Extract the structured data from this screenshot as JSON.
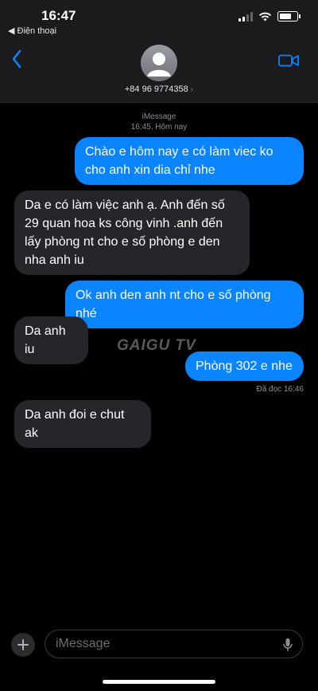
{
  "status_bar": {
    "time": "16:47",
    "back_app": "◀ Điện thoại"
  },
  "header": {
    "contact_number": "+84 96 9774358",
    "chevron": "›"
  },
  "thread_meta": {
    "service": "iMessage",
    "timestamp": "16:45, Hôm nay"
  },
  "messages": [
    {
      "from": "me",
      "text": "Chào e hôm nay e có làm viec ko cho anh xin dia chỉ nhe"
    },
    {
      "from": "them",
      "text": "Da e có làm việc anh ạ. Anh đến số 29 quan hoa ks công vinh .anh đến lấy phòng nt cho e số phòng e den nha anh iu"
    },
    {
      "from": "me",
      "text": "Ok anh den anh nt cho e số phòng nhé"
    },
    {
      "from": "them",
      "text": "Da anh iu"
    },
    {
      "from": "me",
      "text": "Phòng 302 e nhe"
    },
    {
      "from": "them",
      "text": "Da anh đoi e chut ak"
    }
  ],
  "read_receipt": "Đã đọc 16:46",
  "watermark": "GAIGU TV",
  "composer": {
    "placeholder": "iMessage"
  },
  "colors": {
    "sent": "#0a84ff",
    "received": "#26262a",
    "accent": "#0a84ff"
  }
}
